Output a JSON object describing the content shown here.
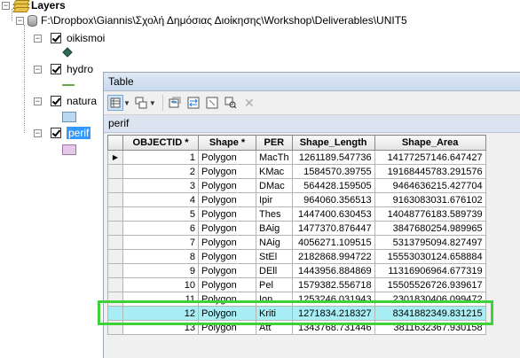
{
  "toc": {
    "root_label": "Layers",
    "workspace_path": "F:\\Dropbox\\Giannis\\Σχολή Δημόσιας Διοίκησης\\Workshop\\Deliverables\\UNIT5",
    "layers": [
      {
        "name": "oikismoi",
        "symbol": "point-diamond",
        "color": "#2e6b5a"
      },
      {
        "name": "hydro",
        "symbol": "line",
        "color": "#6aa84f"
      },
      {
        "name": "natura",
        "symbol": "polygon",
        "color": "#bcd8f0"
      },
      {
        "name": "perif",
        "symbol": "polygon",
        "color": "#e5c7e8",
        "selected": true
      }
    ]
  },
  "table_window": {
    "title": "Table",
    "tab_name": "perif",
    "toolbar_icons": [
      "table-options-icon",
      "related-tables-icon",
      "select-by-attributes-icon",
      "switch-selection-icon",
      "clear-selection-icon",
      "zoom-to-selected-icon",
      "delete-selected-icon"
    ],
    "columns": [
      "OBJECTID *",
      "Shape *",
      "PER",
      "Shape_Length",
      "Shape_Area"
    ],
    "rows": [
      {
        "objectid": "1",
        "shape": "Polygon",
        "per": "MacTh",
        "length": "1261189.547736",
        "area": "14177257146.647427"
      },
      {
        "objectid": "2",
        "shape": "Polygon",
        "per": "KMac",
        "length": "1584570.39755",
        "area": "19168445783.291576"
      },
      {
        "objectid": "3",
        "shape": "Polygon",
        "per": "DMac",
        "length": "564428.159505",
        "area": "9464636215.427704"
      },
      {
        "objectid": "4",
        "shape": "Polygon",
        "per": "Ipir",
        "length": "964060.356513",
        "area": "9163083031.676102"
      },
      {
        "objectid": "5",
        "shape": "Polygon",
        "per": "Thes",
        "length": "1447400.630453",
        "area": "14048776183.589739"
      },
      {
        "objectid": "6",
        "shape": "Polygon",
        "per": "BAig",
        "length": "1477370.876447",
        "area": "3847680254.989965"
      },
      {
        "objectid": "7",
        "shape": "Polygon",
        "per": "NAig",
        "length": "4056271.109515",
        "area": "5313795094.827497"
      },
      {
        "objectid": "8",
        "shape": "Polygon",
        "per": "StEl",
        "length": "2182868.994722",
        "area": "15553030124.658884"
      },
      {
        "objectid": "9",
        "shape": "Polygon",
        "per": "DEll",
        "length": "1443956.884869",
        "area": "11316906964.677319"
      },
      {
        "objectid": "10",
        "shape": "Polygon",
        "per": "Pel",
        "length": "1579382.556718",
        "area": "15505526726.939617"
      },
      {
        "objectid": "11",
        "shape": "Polygon",
        "per": "Ion",
        "length": "1253246.031943",
        "area": "2301830406.099472"
      },
      {
        "objectid": "12",
        "shape": "Polygon",
        "per": "Kriti",
        "length": "1271834.218327",
        "area": "8341882349.831215",
        "highlighted": true
      },
      {
        "objectid": "13",
        "shape": "Polygon",
        "per": "Att",
        "length": "1343768.731446",
        "area": "3811632367.930158"
      }
    ],
    "highlight_color": "#3fd13a"
  }
}
